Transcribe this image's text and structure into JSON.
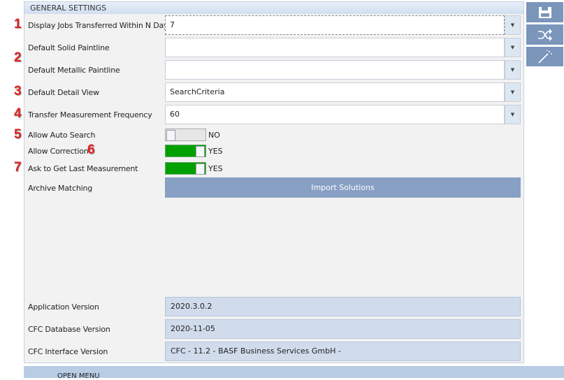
{
  "section_title": "GENERAL SETTINGS",
  "fields": [
    {
      "label": "Display Jobs Transferred Within N Days",
      "value": "7"
    },
    {
      "label": "Default Solid Paintline",
      "value": ""
    },
    {
      "label": "Default Metallic Paintline",
      "value": ""
    },
    {
      "label": "Default Detail View",
      "value": "SearchCriteria"
    },
    {
      "label": "Transfer Measurement Frequency",
      "value": "60"
    }
  ],
  "toggles": [
    {
      "label": "Allow Auto Search",
      "state": "NO",
      "on": false
    },
    {
      "label": "Allow Correction",
      "state": "YES",
      "on": true
    },
    {
      "label": "Ask to Get Last Measurement",
      "state": "YES",
      "on": true
    }
  ],
  "archive": {
    "label": "Archive Matching",
    "button": "Import Solutions"
  },
  "versions": [
    {
      "label": "Application Version",
      "value": "2020.3.0.2"
    },
    {
      "label": "CFC Database Version",
      "value": "2020-11-05"
    },
    {
      "label": "CFC Interface Version",
      "value": "CFC - 11.2 - BASF Business Services GmbH -"
    }
  ],
  "annotations": [
    "1",
    "2",
    "3",
    "4",
    "5",
    "6",
    "7"
  ],
  "toolbar": [
    "save-icon",
    "shuffle-icon",
    "magic-wand-icon"
  ],
  "bottom_bar": "OPEN MENU",
  "colors": {
    "toggle_on": "#00a000",
    "toolbar": "#7b95bb",
    "import_button": "#87a0c4"
  }
}
